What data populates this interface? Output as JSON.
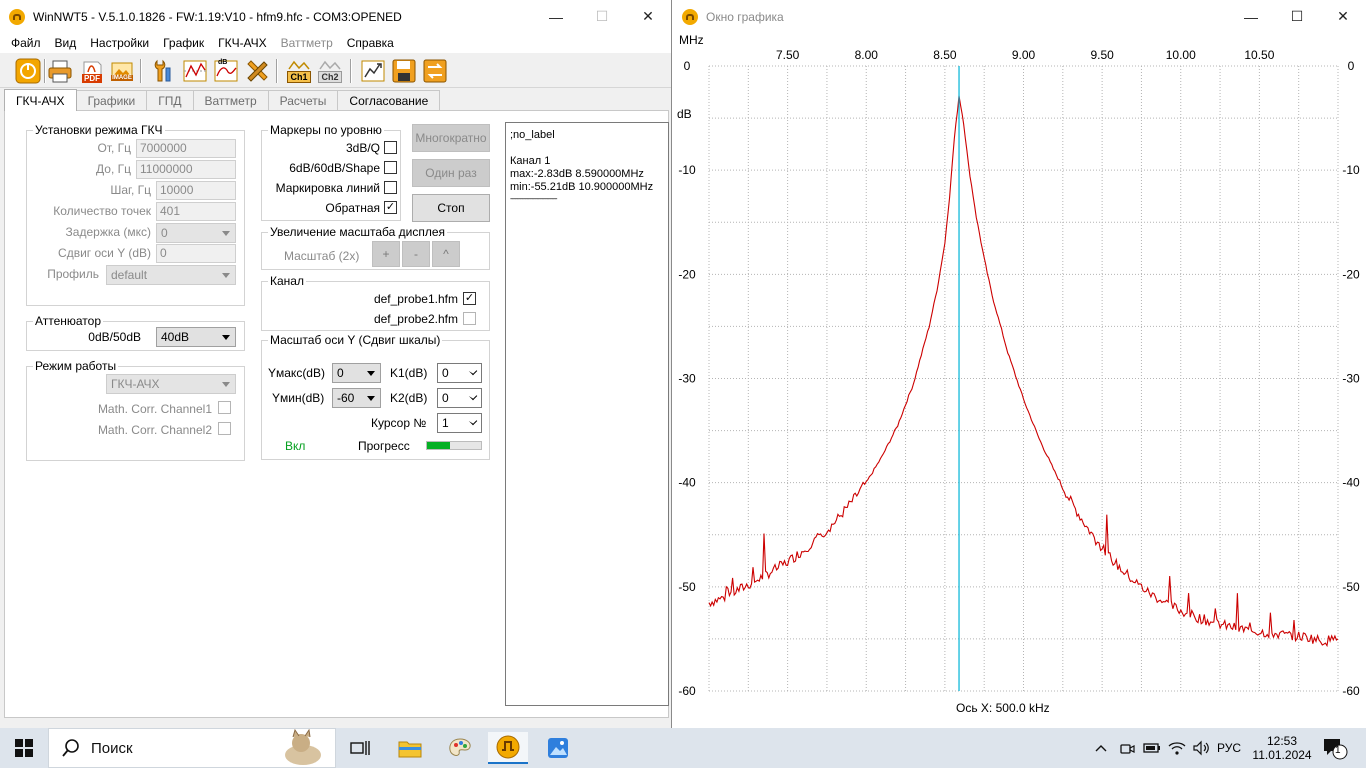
{
  "main_window": {
    "title": "WinNWT5 - V.5.1.0.1826 - FW:1.19:V10 - hfm9.hfc - COM3:OPENED",
    "controls": {
      "minimize": "—",
      "maximize": "☐",
      "close": "✕"
    },
    "menu": [
      {
        "label": "Файл",
        "enabled": true
      },
      {
        "label": "Вид",
        "enabled": true
      },
      {
        "label": "Настройки",
        "enabled": true
      },
      {
        "label": "График",
        "enabled": true
      },
      {
        "label": "ГКЧ-АЧХ",
        "enabled": true
      },
      {
        "label": "Ваттметр",
        "enabled": false
      },
      {
        "label": "Справка",
        "enabled": true
      }
    ],
    "toolbar_icons": [
      "power-icon",
      "printer-icon",
      "pdf-icon",
      "image-icon",
      "wrench-icon",
      "chart-settings-icon",
      "db-chart-icon",
      "tools-icon",
      "ch1-icon",
      "ch2-icon",
      "chart-export-icon",
      "save-icon",
      "swap-icon"
    ],
    "toolbar_text": {
      "pdf": "PDF",
      "image": "IMAGE",
      "db": "dB",
      "ch1": "Ch1",
      "ch2": "Ch2"
    },
    "tabs": [
      {
        "label": "ГКЧ-АЧХ",
        "active": true
      },
      {
        "label": "Графики",
        "active": false
      },
      {
        "label": "ГПД",
        "active": false
      },
      {
        "label": "Ваттметр",
        "active": false
      },
      {
        "label": "Расчеты",
        "active": false
      },
      {
        "label": "Согласование",
        "active": false
      }
    ],
    "gkch": {
      "title": "Установки режима ГКЧ",
      "from_label": "От, Гц",
      "from_value": "7000000",
      "to_label": "До, Гц",
      "to_value": "11000000",
      "step_label": "Шаг, Гц",
      "step_value": "10000",
      "points_label": "Количество точек",
      "points_value": "401",
      "delay_label": "Задержка (мкс)",
      "delay_value": "0",
      "yshift_label": "Сдвиг оси Y (dB)",
      "yshift_value": "0",
      "profile_label": "Профиль",
      "profile_value": "default"
    },
    "attenuator": {
      "title": "Аттенюатор",
      "label": "0dB/50dB",
      "value": "40dB"
    },
    "mode": {
      "title": "Режим работы",
      "value": "ГКЧ-АЧХ",
      "math1_label": "Math. Corr. Channel1",
      "math1_checked": false,
      "math2_label": "Math. Corr. Channel2",
      "math2_checked": false
    },
    "markers": {
      "title": "Маркеры по уровню",
      "items": [
        {
          "label": "3dB/Q",
          "checked": false
        },
        {
          "label": "6dB/60dB/Shape",
          "checked": false
        },
        {
          "label": "Маркировка линий",
          "checked": false
        },
        {
          "label": "Обратная",
          "checked": true
        }
      ]
    },
    "buttons": {
      "multi": "Многократно",
      "once": "Один раз",
      "stop": "Стоп"
    },
    "zoom": {
      "title": "Увеличение масштаба дисплея",
      "label": "Масштаб (2x)",
      "plus": "+",
      "minus": "-",
      "up": "^"
    },
    "channel": {
      "title": "Канал",
      "probe1": "def_probe1.hfm",
      "probe1_checked": true,
      "probe2": "def_probe2.hfm",
      "probe2_checked": false
    },
    "yscale": {
      "title": "Масштаб оси Y (Сдвиг шкалы)",
      "ymax_label": "Yмакс(dB)",
      "ymax_value": "0",
      "ymin_label": "Yмин(dB)",
      "ymin_value": "-60",
      "k1_label": "K1(dB)",
      "k1_value": "0",
      "k2_label": "K2(dB)",
      "k2_value": "0",
      "cursor_label": "Курсор №",
      "cursor_value": "1",
      "on_label": "Вкл",
      "progress_label": "Прогресс",
      "progress_fraction": 0.42
    },
    "info": {
      "line1": ";no_label",
      "line2": "Канал 1",
      "line3": "max:-2.83dB 8.590000MHz",
      "line4": "min:-55.21dB 10.900000MHz",
      "line5": "----------------------------"
    }
  },
  "graph_window": {
    "title": "Окно графика",
    "x_unit": "MHz",
    "y_unit": "dB",
    "x_axis_text": "Ось X: 500.0 kHz",
    "cursor_x": 8.59
  },
  "chart_data": {
    "type": "line",
    "title": "",
    "xlabel": "Ось X: 500.0 kHz",
    "ylabel": "dB",
    "xlim": [
      7.0,
      11.0
    ],
    "ylim": [
      -60,
      0
    ],
    "x_ticks": [
      "7.50",
      "8.00",
      "8.50",
      "9.00",
      "9.50",
      "10.00",
      "10.50"
    ],
    "y_ticks_left": [
      "0",
      "-10",
      "-20",
      "-30",
      "-40",
      "-50",
      "-60"
    ],
    "y_ticks_right": [
      "0",
      "-10",
      "-20",
      "-30",
      "-40",
      "-50",
      "-60"
    ],
    "grid": true,
    "series": [
      {
        "color": "#cc0000",
        "x": [
          7.0,
          7.1,
          7.2,
          7.3,
          7.4,
          7.5,
          7.6,
          7.7,
          7.8,
          7.9,
          8.0,
          8.1,
          8.2,
          8.3,
          8.4,
          8.45,
          8.5,
          8.53,
          8.56,
          8.59,
          8.62,
          8.65,
          8.7,
          8.75,
          8.8,
          8.9,
          9.0,
          9.1,
          9.2,
          9.3,
          9.4,
          9.5,
          9.6,
          9.7,
          9.8,
          9.9,
          10.0,
          10.1,
          10.2,
          10.3,
          10.4,
          10.5,
          10.6,
          10.7,
          10.8,
          10.9,
          11.0
        ],
        "y": [
          -51.5,
          -51.0,
          -50.2,
          -49.4,
          -48.5,
          -47.6,
          -46.5,
          -45.2,
          -43.8,
          -42.0,
          -40.0,
          -37.5,
          -34.5,
          -30.5,
          -25.0,
          -21.5,
          -17.0,
          -12.5,
          -7.0,
          -2.83,
          -5.5,
          -9.5,
          -14.5,
          -18.5,
          -22.0,
          -27.5,
          -32.0,
          -35.8,
          -39.0,
          -41.8,
          -44.2,
          -46.3,
          -48.0,
          -49.4,
          -50.6,
          -51.5,
          -52.3,
          -52.9,
          -53.4,
          -53.8,
          -54.1,
          -54.3,
          -54.5,
          -54.7,
          -54.8,
          -55.21,
          -55.0
        ]
      }
    ],
    "cursor": {
      "x": 8.59,
      "color": "#00b4d8"
    }
  },
  "taskbar": {
    "search_label": "Поиск",
    "lang": "РУС",
    "time": "12:53",
    "date": "11.01.2024",
    "notifications_count": "1"
  }
}
